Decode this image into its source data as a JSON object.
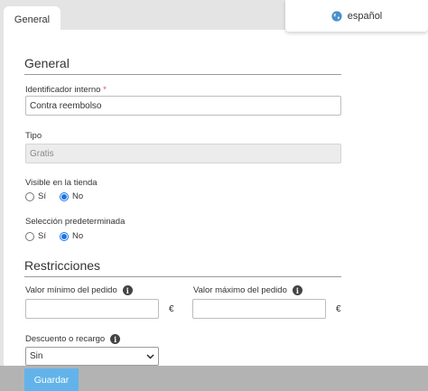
{
  "tabs": {
    "general": "General"
  },
  "language": {
    "label": "español",
    "icon": "globe-icon"
  },
  "sections": {
    "general": "General",
    "restrictions": "Restricciones"
  },
  "fields": {
    "internal_id": {
      "label": "Identificador interno",
      "required_mark": "*",
      "value": "Contra reembolso"
    },
    "type": {
      "label": "Tipo",
      "value": "Gratis"
    },
    "visible_in_store": {
      "label": "Visible en la tienda",
      "options": [
        "Sí",
        "No"
      ],
      "selected": "No"
    },
    "default_selection": {
      "label": "Selección predeterminada",
      "options": [
        "Sí",
        "No"
      ],
      "selected": "No"
    },
    "min_order_value": {
      "label": "Valor mínimo del pedido",
      "value": "",
      "currency": "€"
    },
    "max_order_value": {
      "label": "Valor máximo del pedido",
      "value": "",
      "currency": "€"
    },
    "discount_or_surcharge": {
      "label": "Descuento o recargo",
      "selected": "Sin"
    }
  },
  "info_glyph": "i",
  "buttons": {
    "save": "Guardar"
  },
  "colors": {
    "accent": "#1a73e8",
    "save_button": "#62b3ea",
    "required": "#d9534f",
    "footer": "#b3b3b3"
  }
}
